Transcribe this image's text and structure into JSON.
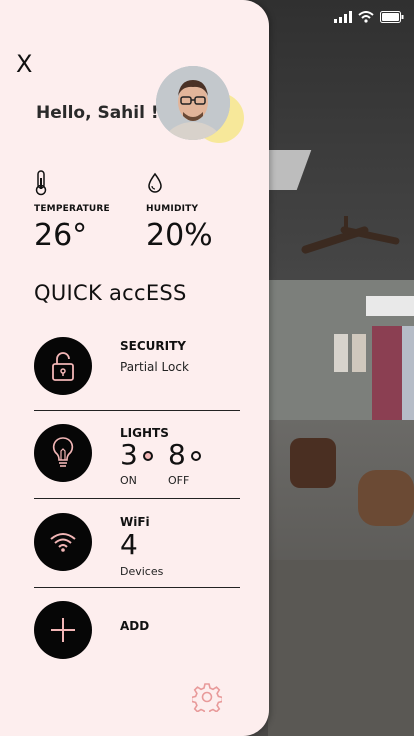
{
  "greeting": "Hello, Sahil !",
  "close_label": "X",
  "sensors": {
    "temperature": {
      "label": "TEMPERATURE",
      "value": "26°",
      "icon": "thermometer-icon"
    },
    "humidity": {
      "label": "HUMIDITY",
      "value": "20%",
      "icon": "droplet-icon"
    }
  },
  "quick_access": {
    "title": "QUICK accESS",
    "security": {
      "title": "SECURITY",
      "status": "Partial Lock",
      "icon": "padlock-icon"
    },
    "lights": {
      "title": "LIGHTS",
      "on_count": "3",
      "on_label": "ON",
      "off_count": "8",
      "off_label": "OFF",
      "icon": "lightbulb-icon"
    },
    "wifi": {
      "title": "WiFi",
      "count": "4",
      "unit": "Devices",
      "icon": "wifi-icon"
    },
    "add": {
      "title": "ADD",
      "icon": "plus-icon"
    }
  },
  "colors": {
    "drawer_bg": "#fdeeee",
    "accent_pink": "#f2b6b6",
    "avatar_accent": "#f7e89a"
  }
}
